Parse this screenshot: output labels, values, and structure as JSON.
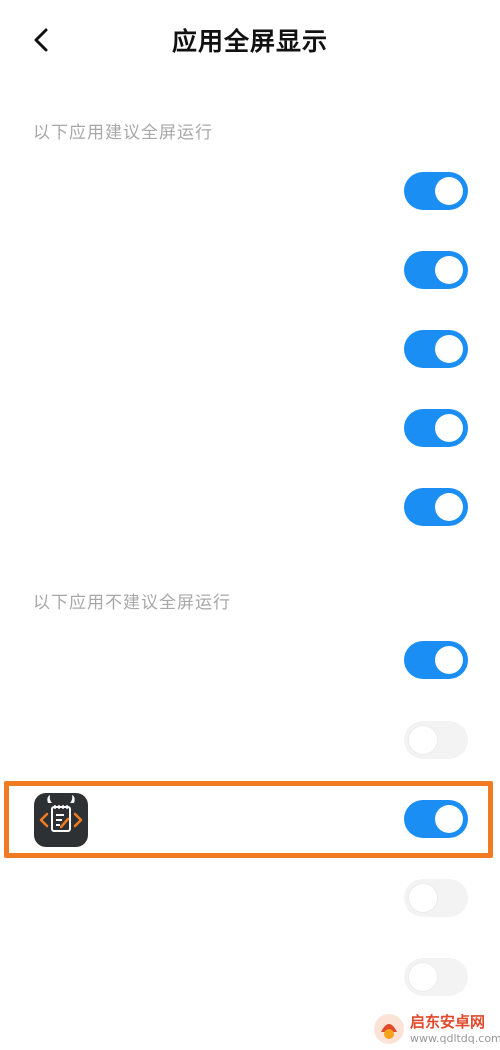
{
  "header": {
    "title": "应用全屏显示"
  },
  "sections": [
    {
      "label": "以下应用建议全屏运行"
    },
    {
      "label": "以下应用不建议全屏运行"
    }
  ],
  "rows": [
    {
      "label": "",
      "enabled": true
    },
    {
      "label": "",
      "enabled": true
    },
    {
      "label": "",
      "enabled": true
    },
    {
      "label": "",
      "enabled": true
    },
    {
      "label": "",
      "enabled": true
    },
    {
      "label": "",
      "enabled": true
    },
    {
      "label": "",
      "enabled": false
    },
    {
      "label": "",
      "enabled": true,
      "highlighted": true
    },
    {
      "label": "",
      "enabled": false
    },
    {
      "label": "",
      "enabled": false
    }
  ],
  "colors": {
    "toggle_on": "#1a8ef3",
    "toggle_off": "#f3f3f3",
    "highlight": "#f07b22",
    "app_icon_bg": "#2e3133",
    "app_icon_accent": "#f07b22"
  },
  "icons": {
    "back": "chevron-left-icon",
    "app": "code-notepad-app-icon"
  },
  "watermark": {
    "title": "启东安卓网",
    "url": "www.qdltdq.com"
  }
}
